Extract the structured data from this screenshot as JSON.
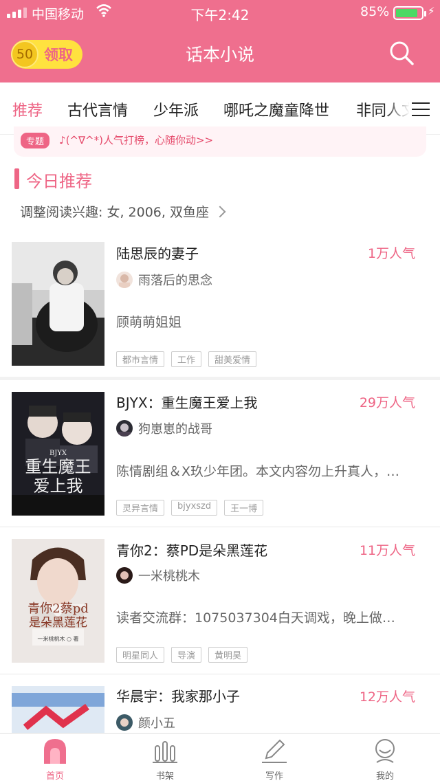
{
  "status_bar": {
    "carrier": "中国移动",
    "time": "下午2:42",
    "battery_percent": "85%",
    "battery_level": 0.85,
    "wifi_icon": "wifi-icon"
  },
  "header": {
    "coin_count": "50",
    "claim_label": "领取",
    "title": "话本小说",
    "search_icon": "search-icon"
  },
  "tabs": [
    {
      "label": "推荐",
      "active": true
    },
    {
      "label": "古代言情",
      "active": false
    },
    {
      "label": "少年派",
      "active": false
    },
    {
      "label": "哪吒之魔童降世",
      "active": false
    },
    {
      "label": "非同人文",
      "active": false
    }
  ],
  "promo": {
    "tag": "专题",
    "text": "♪(^∇^*)人气打榜，心随你动>>"
  },
  "section": {
    "title": "今日推荐",
    "interest": "调整阅读兴趣: 女, 2006, 双鱼座"
  },
  "books": [
    {
      "title": "陆思辰的妻子",
      "popularity": "1万人气",
      "author": "雨落后的思念",
      "description": "顾萌萌姐姐",
      "tags": [
        "都市言情",
        "工作",
        "甜美爱情"
      ]
    },
    {
      "title": "BJYX：重生魔王爱上我",
      "popularity": "29万人气",
      "author": "狗崽崽的战哥",
      "description": "陈情剧组＆X玖少年团。本文内容勿上升真人，…",
      "tags": [
        "灵异言情",
        "bjyxszd",
        "王一博"
      ],
      "cover_text": [
        "BJYX",
        "重生魔王",
        "爱上我"
      ]
    },
    {
      "title": "青你2：蔡PD是朵黑莲花",
      "popularity": "11万人气",
      "author": "一米桃桃木",
      "description": "读者交流群：1075037304白天调戏，晚上做…",
      "tags": [
        "明星同人",
        "导演",
        "黄明昊"
      ],
      "cover_text": [
        "青你2",
        "蔡pd",
        "是朵黑莲花",
        "一米桃桃木 ○ 著"
      ]
    },
    {
      "title": "华晨宇：我家那小子",
      "popularity": "12万人气",
      "author": "颜小五"
    }
  ],
  "bottom_nav": [
    {
      "label": "首页",
      "icon": "home-icon",
      "active": true
    },
    {
      "label": "书架",
      "icon": "bookshelf-icon",
      "active": false
    },
    {
      "label": "写作",
      "icon": "pen-icon",
      "active": false
    },
    {
      "label": "我的",
      "icon": "profile-icon",
      "active": false
    }
  ],
  "colors": {
    "brand_pink": "#ef6f8e",
    "accent_pink": "#ee6585",
    "coin_yellow": "#ffe23f"
  }
}
